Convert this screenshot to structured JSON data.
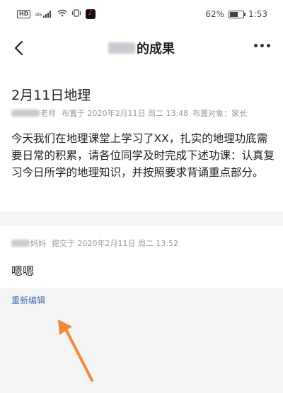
{
  "status_bar": {
    "left_icons": [
      "hd-icon",
      "signal-icon",
      "wifi-icon",
      "vibrate-icon",
      "tiktok-icon"
    ],
    "signal_label": "4G",
    "hd_label": "HD",
    "battery": "62%",
    "battery_level": 0.62,
    "time": "1:53"
  },
  "nav": {
    "title_suffix": "的成果"
  },
  "homework": {
    "title": "2月11日地理",
    "teacher_suffix": "老师",
    "published_label": "布置于 2020年2月11日 周二 13:48",
    "target_label": "布置对象：家长",
    "content": "今天我们在地理课堂上学习了XX，扎实的地理功底需要日常的积累，请各位同学及时完成下述功课：认真复习今日所学的地理知识，并按照要求背诵重点部分。"
  },
  "reply": {
    "author_suffix": "妈妈",
    "submitted_label": "提交于 2020年2月11日 周二 13:52",
    "text": "嗯嗯"
  },
  "actions": {
    "reedit_label": "重新编辑"
  },
  "colors": {
    "link": "#4a6ea9",
    "arrow": "#f08a3c",
    "background": "#f4f4f4"
  }
}
